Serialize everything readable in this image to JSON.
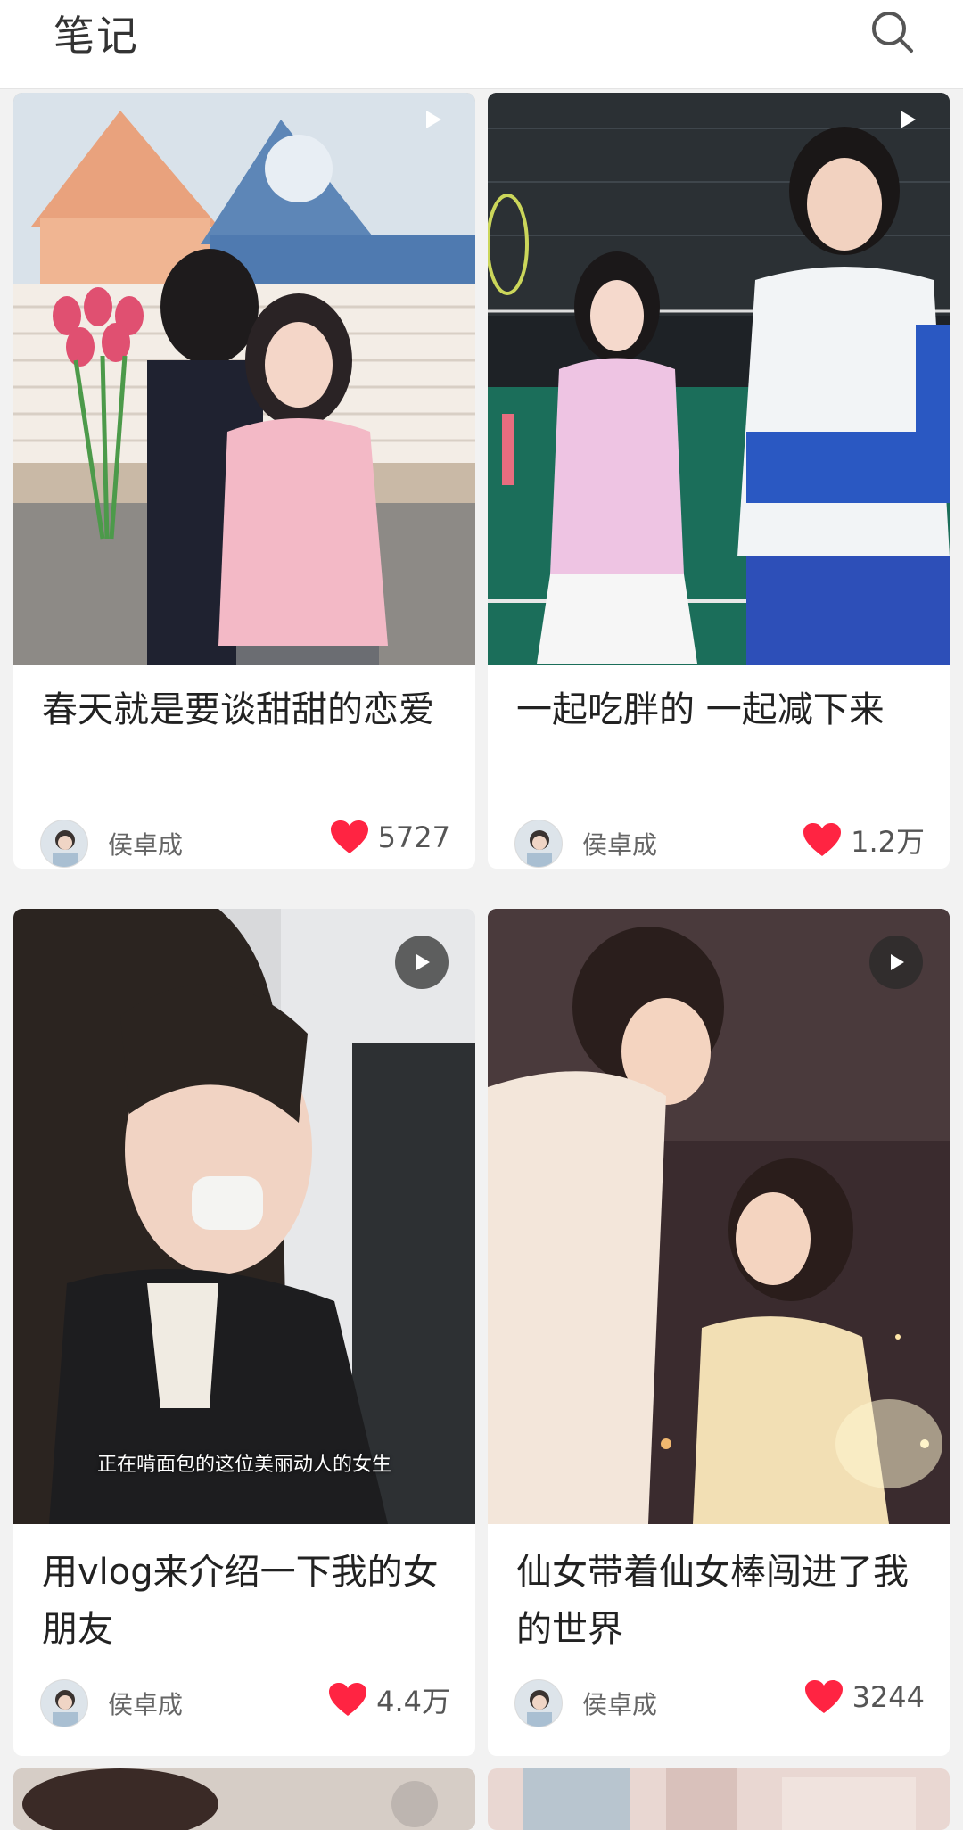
{
  "header": {
    "title": "笔记"
  },
  "icons": {
    "search": "search-icon",
    "play": "play-icon",
    "heart": "heart-icon"
  },
  "colors": {
    "heart": "#ff2442",
    "title": "#222222"
  },
  "notes": [
    {
      "title": "春天就是要谈甜甜的恋爱",
      "author": "侯卓成",
      "likes": "5727",
      "video": true
    },
    {
      "title": "一起吃胖的 一起减下来",
      "author": "侯卓成",
      "likes": "1.2万",
      "video": true
    },
    {
      "title": "用vlog来介绍一下我的女朋友",
      "author": "侯卓成",
      "likes": "4.4万",
      "video": true,
      "subtitle": "正在啃面包的这位美丽动人的女生"
    },
    {
      "title": "仙女带着仙女棒闯进了我的世界",
      "author": "侯卓成",
      "likes": "3244",
      "video": true
    }
  ]
}
